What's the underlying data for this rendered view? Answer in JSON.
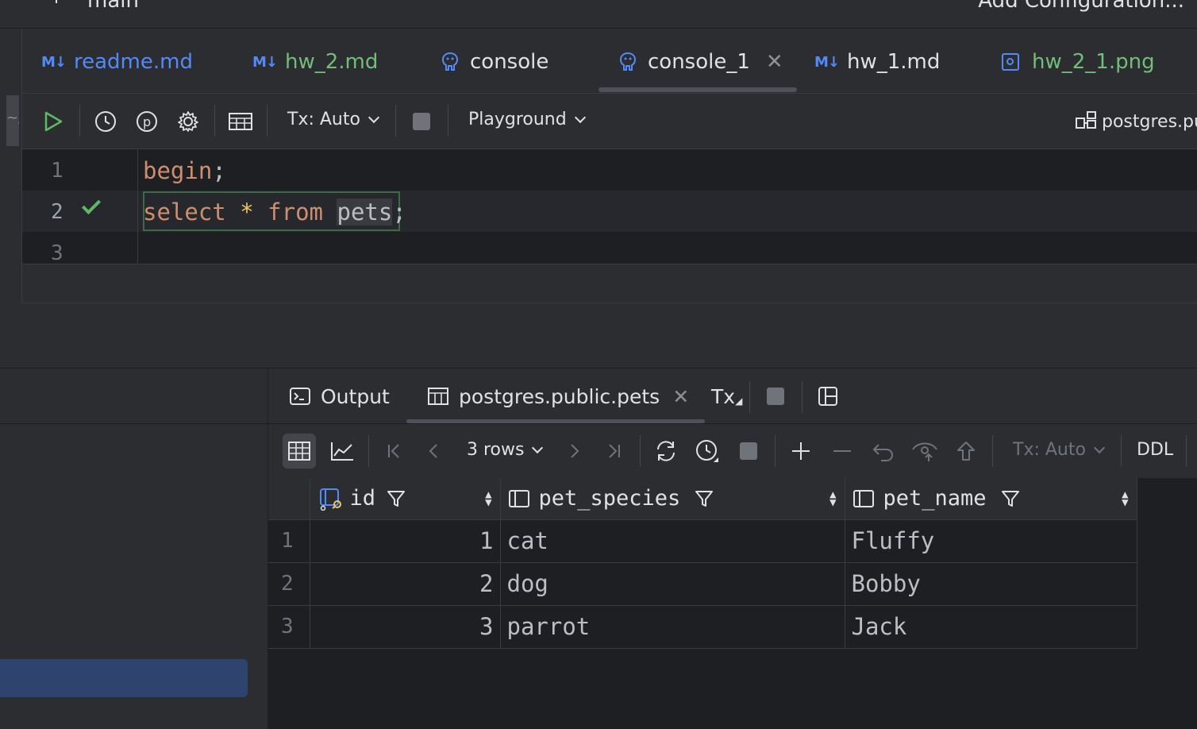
{
  "topbar": {
    "branch": "main",
    "add_configuration": "Add Configuration..."
  },
  "left_crumb": "~/s",
  "tabs": [
    {
      "label": "readme.md",
      "badge": "M↓",
      "color": "#548af7"
    },
    {
      "label": "hw_2.md",
      "badge": "M↓",
      "color": "#73bd79"
    },
    {
      "label": "console",
      "badge": "",
      "color": "#dfe1e5"
    },
    {
      "label": "console_1",
      "badge": "",
      "color": "#dfe1e5",
      "active": true
    },
    {
      "label": "hw_1.md",
      "badge": "M↓",
      "color": "#dfe1e5"
    },
    {
      "label": "hw_2_1.png",
      "badge": "",
      "color": "#73bd79"
    }
  ],
  "editor_toolbar": {
    "tx_mode": "Tx: Auto",
    "schema_mode": "Playground",
    "datasource": "postgres.pu"
  },
  "editor": {
    "line_numbers": [
      "1",
      "2",
      "3"
    ],
    "line1": {
      "kw": "begin",
      "punc": ";"
    },
    "line2": {
      "kw1": "select",
      "star": "*",
      "kw2": "from",
      "table": "pets",
      "punc": ";"
    }
  },
  "services_tabs": {
    "output": "Output",
    "result": "postgres.public.pets",
    "tx": "Tx"
  },
  "result_toolbar": {
    "rows": "3 rows",
    "tx_mode": "Tx: Auto",
    "ddl": "DDL"
  },
  "grid": {
    "columns": [
      "id",
      "pet_species",
      "pet_name"
    ],
    "rows": [
      {
        "n": "1",
        "id": "1",
        "pet_species": "cat",
        "pet_name": "Fluffy"
      },
      {
        "n": "2",
        "id": "2",
        "pet_species": "dog",
        "pet_name": "Bobby"
      },
      {
        "n": "3",
        "id": "3",
        "pet_species": "parrot",
        "pet_name": "Jack"
      }
    ]
  },
  "colors": {
    "accent_blue": "#548af7",
    "modified_green": "#73bd79",
    "keyword": "#cf8e6d",
    "success_check": "#5fb865",
    "selection": "#2e436e"
  }
}
